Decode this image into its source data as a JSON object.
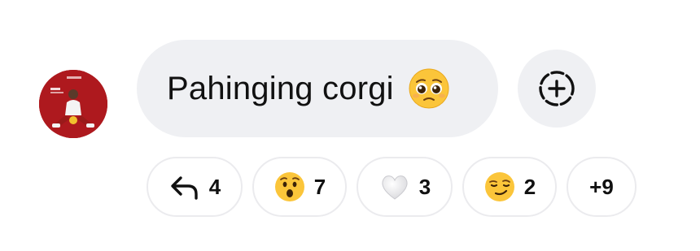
{
  "message": {
    "text": "Pahinging corgi",
    "emoji": "pleading-face-emoji"
  },
  "add_reaction": {
    "icon": "add-reaction-icon"
  },
  "reactions": [
    {
      "icon": "reply-arrow-icon",
      "count": "4"
    },
    {
      "icon": "astonished-face-emoji",
      "count": "7"
    },
    {
      "icon": "white-heart-emoji",
      "count": "3"
    },
    {
      "icon": "smirking-face-emoji",
      "count": "2"
    }
  ],
  "more_reactions": {
    "label": "+9"
  },
  "colors": {
    "bubble_bg": "#eff0f3",
    "pill_border": "#ebebee",
    "emoji_yellow": "#fbc53a",
    "avatar_bg": "#a4161a"
  }
}
